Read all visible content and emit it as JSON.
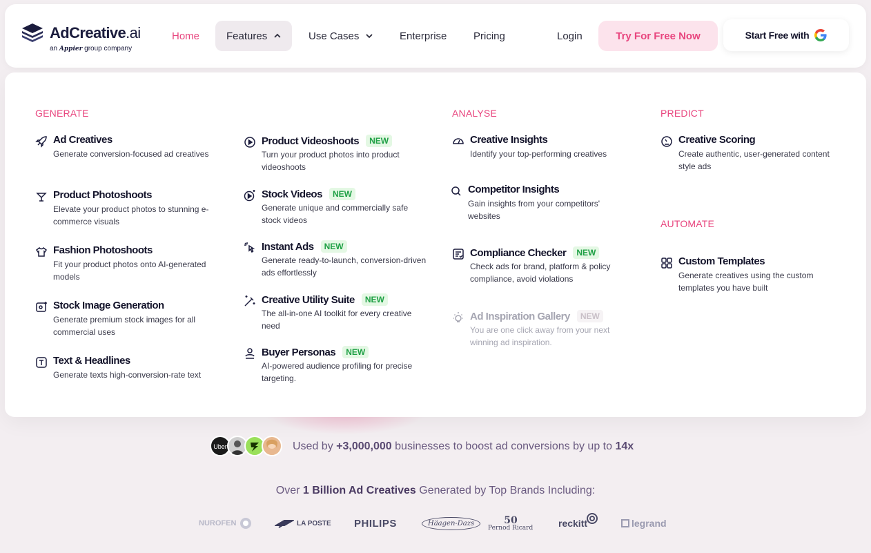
{
  "logo": {
    "name": "AdCreative",
    "suffix": ".ai",
    "sub_prefix": "an",
    "sub_brand": "Appier",
    "sub_suffix": "group company"
  },
  "nav": {
    "home": "Home",
    "features": "Features",
    "use_cases": "Use Cases",
    "enterprise": "Enterprise",
    "pricing": "Pricing",
    "login": "Login",
    "try_free": "Try For Free Now",
    "start_free": "Start Free with"
  },
  "menu": {
    "generate": {
      "title": "GENERATE",
      "items": [
        {
          "title": "Ad Creatives",
          "desc": "Generate conversion-focused ad creatives",
          "icon": "rocket-icon"
        },
        {
          "title": "Product Photoshoots",
          "desc": "Elevate your product photos to stunning e-commerce visuals",
          "icon": "cocktail-icon"
        },
        {
          "title": "Fashion Photoshoots",
          "desc": "Fit your product photos onto AI-generated models",
          "icon": "shirt-icon"
        },
        {
          "title": "Stock Image Generation",
          "desc": "Generate premium stock images for all commercial uses",
          "icon": "image-sparkle-icon"
        },
        {
          "title": "Text & Headlines",
          "desc": "Generate texts high-conversion-rate text",
          "icon": "text-icon"
        }
      ]
    },
    "generate2": {
      "items": [
        {
          "title": "Product Videoshoots",
          "badge": "NEW",
          "desc": "Turn your product photos into product videoshoots",
          "icon": "play-circle-icon"
        },
        {
          "title": "Stock Videos",
          "badge": "NEW",
          "desc": "Generate unique and commercially safe stock videos",
          "icon": "play-sparkle-icon"
        },
        {
          "title": "Instant Ads",
          "badge": "NEW",
          "desc": "Generate ready-to-launch, conversion-driven ads effortlessly",
          "icon": "cursor-click-icon"
        },
        {
          "title": "Creative Utility Suite",
          "badge": "NEW",
          "desc": "The all-in-one AI toolkit for every creative need",
          "icon": "magic-wand-icon"
        },
        {
          "title": "Buyer Personas",
          "badge": "NEW",
          "desc": "AI-powered audience profiling for precise targeting.",
          "icon": "person-icon"
        }
      ]
    },
    "analyse": {
      "title": "ANALYSE",
      "items": [
        {
          "title": "Creative Insights",
          "desc": "Identify your top-performing creatives",
          "icon": "gauge-icon"
        },
        {
          "title": "Competitor Insights",
          "desc": "Gain insights from your competitors' websites",
          "icon": "search-icon"
        },
        {
          "title": "Compliance Checker",
          "badge": "NEW",
          "desc": "Check ads for brand, platform & policy compliance, avoid violations",
          "icon": "checklist-icon"
        },
        {
          "title": "Ad Inspiration Gallery",
          "badge": "NEW",
          "desc": "You are one click away from your next winning ad inspiration.",
          "icon": "lightbulb-icon"
        }
      ]
    },
    "predict": {
      "title": "PREDICT",
      "items": [
        {
          "title": "Creative Scoring",
          "desc": "Create authentic, user-generated content style ads",
          "icon": "score-icon"
        }
      ]
    },
    "automate": {
      "title": "AUTOMATE",
      "items": [
        {
          "title": "Custom Templates",
          "desc": "Generate creatives using the custom templates you have built",
          "icon": "templates-icon"
        }
      ]
    }
  },
  "social_proof": {
    "prefix": "Used by",
    "count": "+3,000,000",
    "middle": "businesses to boost ad conversions by up to",
    "multiplier": "14x"
  },
  "brands_line": {
    "prefix": "Over",
    "highlight": "1 Billion Ad Creatives",
    "suffix": "Generated by Top Brands Including:"
  },
  "brands": [
    "NUROFEN",
    "LA POSTE",
    "PHILIPS",
    "Häagen-Dazs",
    "Pernod Ricard",
    "reckitt",
    "legrand"
  ],
  "colors": {
    "accent": "#e8457e",
    "new_badge": "#1fa045",
    "text": "#14142b"
  }
}
